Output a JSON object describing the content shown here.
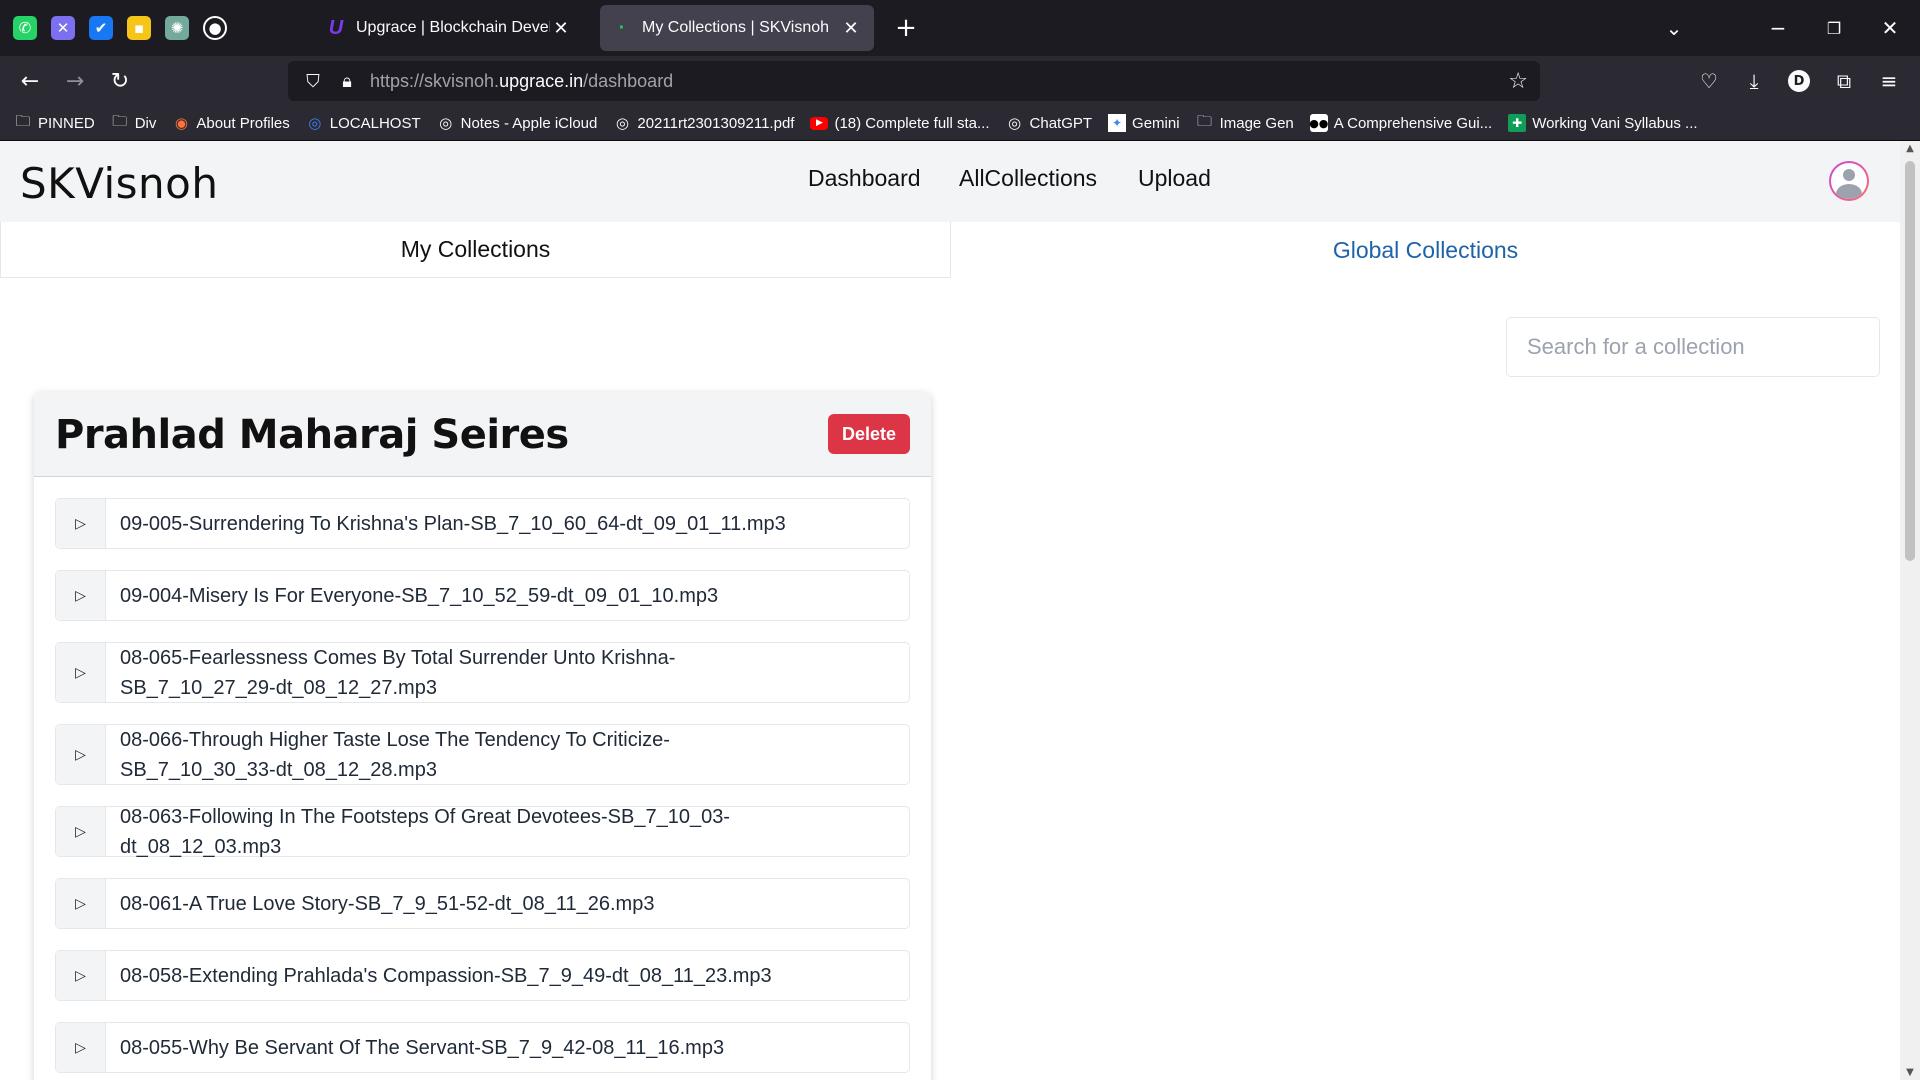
{
  "browser": {
    "pinned_icons": [
      {
        "icon": "whatsapp-icon",
        "color": "#25d366",
        "glyph": "✆"
      },
      {
        "icon": "tools-icon",
        "color": "#7c6ff0",
        "glyph": "✕"
      },
      {
        "icon": "checkmark-icon",
        "color": "#1877f2",
        "glyph": "✔"
      },
      {
        "icon": "notes-icon",
        "color": "#f5c518",
        "glyph": "▪"
      },
      {
        "icon": "chatgpt-icon",
        "color": "#74aa9c",
        "glyph": "✺"
      },
      {
        "icon": "github-icon",
        "color": "#ffffff",
        "glyph": "●"
      }
    ],
    "tabs": [
      {
        "label": "Upgrace | Blockchain Develope",
        "icon_glyph": "U",
        "icon_color": "#7c3aed"
      },
      {
        "label": "My Collections | SKVisnoh",
        "icon_glyph": "·",
        "icon_color": "#22c55e"
      }
    ],
    "url_prefix": "https://skvisnoh.",
    "url_domain": "upgrace.in",
    "url_path": "/dashboard",
    "bookmarks": [
      {
        "label": "PINNED",
        "icon": "folder-icon",
        "glyph": "🗀"
      },
      {
        "label": "Div",
        "icon": "folder-icon",
        "glyph": "🗀"
      },
      {
        "label": "About Profiles",
        "icon": "firefox-icon",
        "glyph": "◉"
      },
      {
        "label": "LOCALHOST",
        "icon": "globe-icon",
        "glyph": "◎"
      },
      {
        "label": "Notes - Apple iCloud",
        "icon": "globe-icon",
        "glyph": "◎"
      },
      {
        "label": "20211rt2301309211.pdf",
        "icon": "globe-icon",
        "glyph": "◎"
      },
      {
        "label": "(18) Complete full sta...",
        "icon": "youtube-icon",
        "glyph": "▶"
      },
      {
        "label": "ChatGPT",
        "icon": "globe-icon",
        "glyph": "◎"
      },
      {
        "label": "Gemini",
        "icon": "gemini-icon",
        "glyph": "✦"
      },
      {
        "label": "Image Gen",
        "icon": "folder-icon",
        "glyph": "🗀"
      },
      {
        "label": "A Comprehensive Gui...",
        "icon": "medium-icon",
        "glyph": "●"
      },
      {
        "label": "Working Vani Syllabus ...",
        "icon": "sheets-icon",
        "glyph": "✚"
      }
    ]
  },
  "site": {
    "brand": "SKVisnoh",
    "nav": [
      "Dashboard",
      "AllCollections",
      "Upload"
    ],
    "tabs": {
      "my": "My Collections",
      "global": "Global Collections"
    },
    "search_placeholder": "Search for a collection",
    "accent_color": "#1d63a8",
    "danger_color": "#dc3545"
  },
  "collection": {
    "title": "Prahlad Maharaj Seires",
    "delete_label": "Delete",
    "play_glyph": "▷",
    "tracks": [
      "09-005-Surrendering To Krishna's Plan-SB_7_10_60_64-dt_09_01_11.mp3",
      "09-004-Misery Is For Everyone-SB_7_10_52_59-dt_09_01_10.mp3",
      "08-065-Fearlessness Comes By Total Surrender Unto Krishna-SB_7_10_27_29-dt_08_12_27.mp3",
      "08-066-Through Higher Taste Lose The Tendency To Criticize-SB_7_10_30_33-dt_08_12_28.mp3",
      "08-063-Following In The Footsteps Of Great Devotees-SB_7_10_03-dt_08_12_03.mp3",
      "08-061-A True Love Story-SB_7_9_51-52-dt_08_11_26.mp3",
      "08-058-Extending Prahlada's Compassion-SB_7_9_49-dt_08_11_23.mp3",
      "08-055-Why Be Servant Of The Servant-SB_7_9_42-08_11_16.mp3"
    ]
  }
}
